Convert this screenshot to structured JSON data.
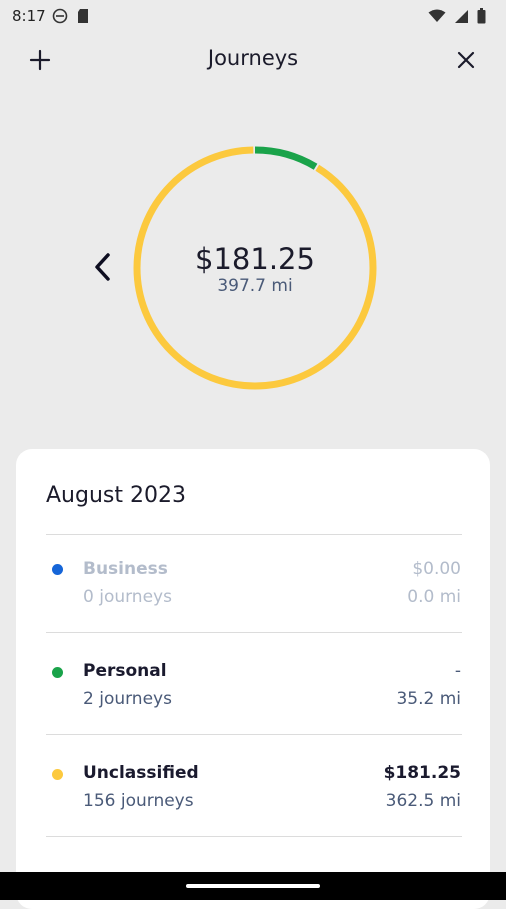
{
  "status_bar": {
    "time": "8:17",
    "left_icons": [
      "do-not-disturb-icon",
      "sd-card-icon"
    ],
    "right_icons": [
      "wifi-icon",
      "signal-icon",
      "battery-icon"
    ]
  },
  "header": {
    "title": "Journeys",
    "add_icon": "plus-icon",
    "close_icon": "close-icon"
  },
  "summary": {
    "amount": "$181.25",
    "distance": "397.7 mi",
    "prev_icon": "chevron-left-icon",
    "ring_segments": [
      {
        "name": "Personal",
        "fraction": 0.0885,
        "color": "#1aa34a"
      },
      {
        "name": "Unclassified",
        "fraction": 0.9115,
        "color": "#fcc93e"
      }
    ]
  },
  "card": {
    "month": "August 2023",
    "rows": [
      {
        "label": "Business",
        "journeys": "0 journeys",
        "value": "$0.00",
        "distance": "0.0 mi",
        "color": "#1565d8",
        "muted": true
      },
      {
        "label": "Personal",
        "journeys": "2 journeys",
        "value": "-",
        "distance": "35.2 mi",
        "color": "#1aa34a",
        "muted": false
      },
      {
        "label": "Unclassified",
        "journeys": "156 journeys",
        "value": "$181.25",
        "distance": "362.5 mi",
        "color": "#fcc93e",
        "muted": false
      }
    ]
  }
}
